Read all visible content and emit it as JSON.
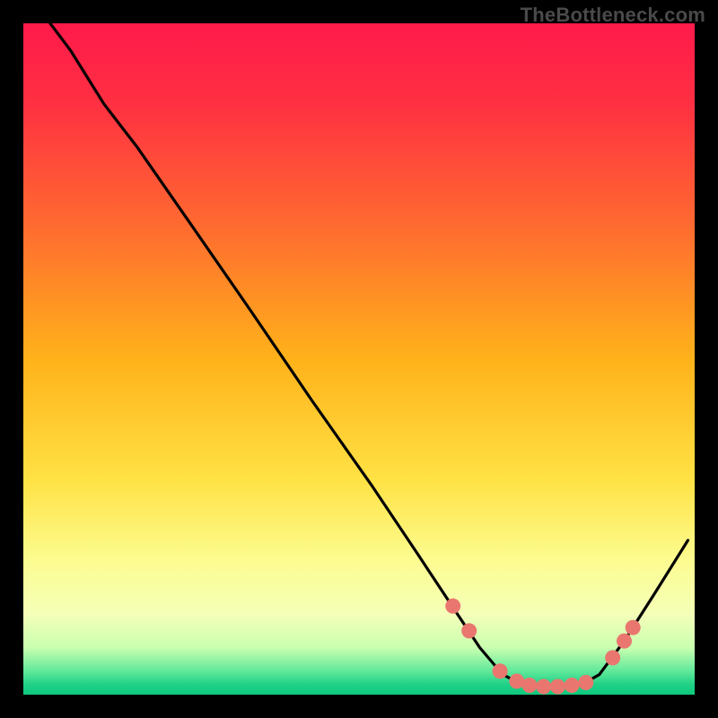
{
  "watermark": "TheBottleneck.com",
  "gradient": {
    "stops": [
      {
        "offset": 0.0,
        "color": "#ff1a4b"
      },
      {
        "offset": 0.12,
        "color": "#ff3042"
      },
      {
        "offset": 0.3,
        "color": "#ff6a30"
      },
      {
        "offset": 0.5,
        "color": "#ffb21a"
      },
      {
        "offset": 0.68,
        "color": "#ffe244"
      },
      {
        "offset": 0.8,
        "color": "#fcfc90"
      },
      {
        "offset": 0.88,
        "color": "#f5ffb8"
      },
      {
        "offset": 0.93,
        "color": "#c9ffb0"
      },
      {
        "offset": 0.965,
        "color": "#61e89a"
      },
      {
        "offset": 0.985,
        "color": "#1fd187"
      },
      {
        "offset": 1.0,
        "color": "#0fc97e"
      }
    ]
  },
  "curve": {
    "stroke": "#000000",
    "stroke_width": 3.2,
    "points": [
      {
        "x": 0.04,
        "y": 0.0
      },
      {
        "x": 0.07,
        "y": 0.04
      },
      {
        "x": 0.12,
        "y": 0.12
      },
      {
        "x": 0.17,
        "y": 0.185
      },
      {
        "x": 0.25,
        "y": 0.3
      },
      {
        "x": 0.34,
        "y": 0.43
      },
      {
        "x": 0.43,
        "y": 0.562
      },
      {
        "x": 0.52,
        "y": 0.69
      },
      {
        "x": 0.587,
        "y": 0.79
      },
      {
        "x": 0.64,
        "y": 0.87
      },
      {
        "x": 0.68,
        "y": 0.93
      },
      {
        "x": 0.714,
        "y": 0.97
      },
      {
        "x": 0.745,
        "y": 0.986
      },
      {
        "x": 0.79,
        "y": 0.99
      },
      {
        "x": 0.83,
        "y": 0.986
      },
      {
        "x": 0.858,
        "y": 0.97
      },
      {
        "x": 0.895,
        "y": 0.92
      },
      {
        "x": 0.94,
        "y": 0.85
      },
      {
        "x": 0.99,
        "y": 0.77
      }
    ]
  },
  "dots": {
    "fill": "#e9776f",
    "radius": 8.5,
    "points": [
      {
        "x": 0.64,
        "y": 0.868
      },
      {
        "x": 0.664,
        "y": 0.905
      },
      {
        "x": 0.71,
        "y": 0.965
      },
      {
        "x": 0.735,
        "y": 0.98
      },
      {
        "x": 0.754,
        "y": 0.986
      },
      {
        "x": 0.775,
        "y": 0.988
      },
      {
        "x": 0.796,
        "y": 0.988
      },
      {
        "x": 0.817,
        "y": 0.986
      },
      {
        "x": 0.838,
        "y": 0.982
      },
      {
        "x": 0.878,
        "y": 0.945
      },
      {
        "x": 0.895,
        "y": 0.92
      },
      {
        "x": 0.908,
        "y": 0.9
      }
    ]
  },
  "chart_data": {
    "type": "line",
    "title": "",
    "xlabel": "",
    "ylabel": "",
    "xlim": [
      0,
      1
    ],
    "ylim": [
      0,
      1
    ],
    "note": "Axes are unlabeled in source; x/y expressed as normalized fractions of plot area (y measured from top).",
    "series": [
      {
        "name": "bottleneck-curve",
        "x": [
          0.04,
          0.07,
          0.12,
          0.17,
          0.25,
          0.34,
          0.43,
          0.52,
          0.587,
          0.64,
          0.68,
          0.714,
          0.745,
          0.79,
          0.83,
          0.858,
          0.895,
          0.94,
          0.99
        ],
        "y_from_top": [
          0.0,
          0.04,
          0.12,
          0.185,
          0.3,
          0.43,
          0.562,
          0.69,
          0.79,
          0.87,
          0.93,
          0.97,
          0.986,
          0.99,
          0.986,
          0.97,
          0.92,
          0.85,
          0.77
        ]
      },
      {
        "name": "highlight-dots",
        "x": [
          0.64,
          0.664,
          0.71,
          0.735,
          0.754,
          0.775,
          0.796,
          0.817,
          0.838,
          0.878,
          0.895,
          0.908
        ],
        "y_from_top": [
          0.868,
          0.905,
          0.965,
          0.98,
          0.986,
          0.988,
          0.988,
          0.986,
          0.982,
          0.945,
          0.92,
          0.9
        ]
      }
    ],
    "background_gradient_vertical": [
      {
        "offset": 0.0,
        "color": "#ff1a4b"
      },
      {
        "offset": 0.5,
        "color": "#ffb21a"
      },
      {
        "offset": 0.8,
        "color": "#fcfc90"
      },
      {
        "offset": 1.0,
        "color": "#0fc97e"
      }
    ]
  }
}
